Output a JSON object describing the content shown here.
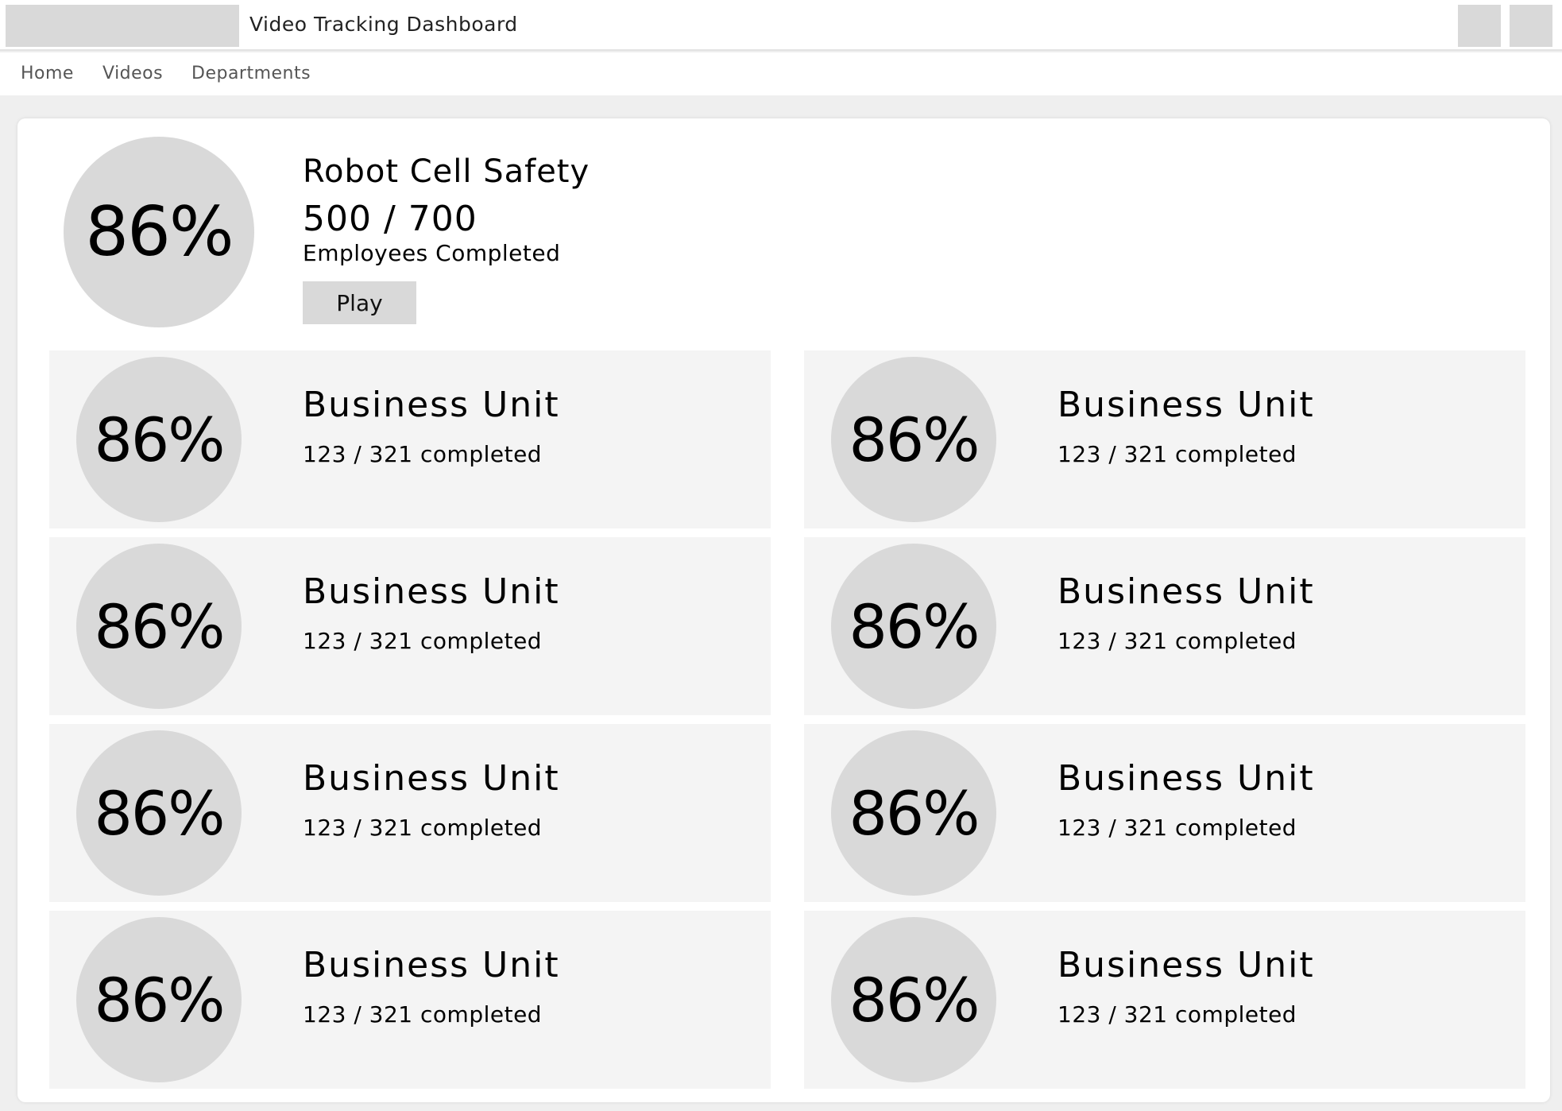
{
  "header": {
    "title": "Video Tracking Dashboard"
  },
  "nav": {
    "items": [
      "Home",
      "Videos",
      "Departments"
    ]
  },
  "hero": {
    "percent": "86%",
    "title": "Robot Cell Safety",
    "count": "500 / 700",
    "subtitle": "Employees Completed",
    "play_label": "Play"
  },
  "units": [
    {
      "percent": "86%",
      "title": "Business Unit",
      "count": "123 / 321 completed"
    },
    {
      "percent": "86%",
      "title": "Business Unit",
      "count": "123 / 321 completed"
    },
    {
      "percent": "86%",
      "title": "Business Unit",
      "count": "123 / 321 completed"
    },
    {
      "percent": "86%",
      "title": "Business Unit",
      "count": "123 / 321 completed"
    },
    {
      "percent": "86%",
      "title": "Business Unit",
      "count": "123 / 321 completed"
    },
    {
      "percent": "86%",
      "title": "Business Unit",
      "count": "123 / 321 completed"
    },
    {
      "percent": "86%",
      "title": "Business Unit",
      "count": "123 / 321 completed"
    },
    {
      "percent": "86%",
      "title": "Business Unit",
      "count": "123 / 321 completed"
    }
  ]
}
